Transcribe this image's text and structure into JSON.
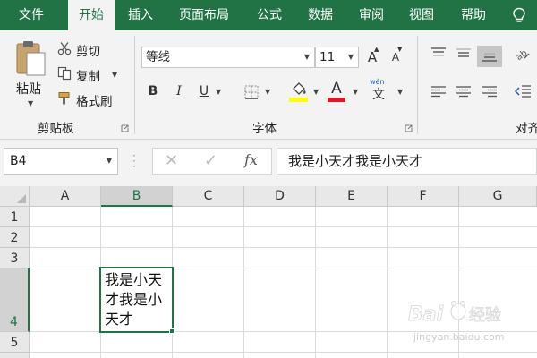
{
  "ribbon_tabs": [
    "文件",
    "开始",
    "插入",
    "页面布局",
    "公式",
    "数据",
    "审阅",
    "视图",
    "帮助"
  ],
  "active_tab": "开始",
  "clipboard": {
    "paste_label": "粘贴",
    "cut_label": "剪切",
    "copy_label": "复制",
    "format_painter_label": "格式刷",
    "group_label": "剪贴板"
  },
  "font": {
    "name": "等线",
    "size": "11",
    "bold": "B",
    "italic": "I",
    "underline": "U",
    "font_color_letter": "A",
    "font_color": "#e81123",
    "highlight_color": "#ffff00",
    "increase_size": "A",
    "decrease_size": "A",
    "phonetic": "文",
    "group_label": "字体"
  },
  "alignment": {
    "group_label_partial": "对齐"
  },
  "formula_bar": {
    "name_box": "B4",
    "cancel_icon": "✕",
    "enter_icon": "✓",
    "fx_label": "fx",
    "formula_text": "我是小天才我是小天才"
  },
  "grid": {
    "columns": [
      "A",
      "B",
      "C",
      "D",
      "E",
      "F",
      "G"
    ],
    "rows": [
      "1",
      "2",
      "3",
      "4",
      "5"
    ],
    "selected_column": "B",
    "selected_row": "4",
    "active_cell_text": "我是小天才我是小天才"
  },
  "watermark": {
    "brand": "Baidu经验",
    "url": "jingyan.baidu.com"
  },
  "colors": {
    "excel_green": "#217346",
    "ribbon_bg": "#f3f3f3"
  }
}
